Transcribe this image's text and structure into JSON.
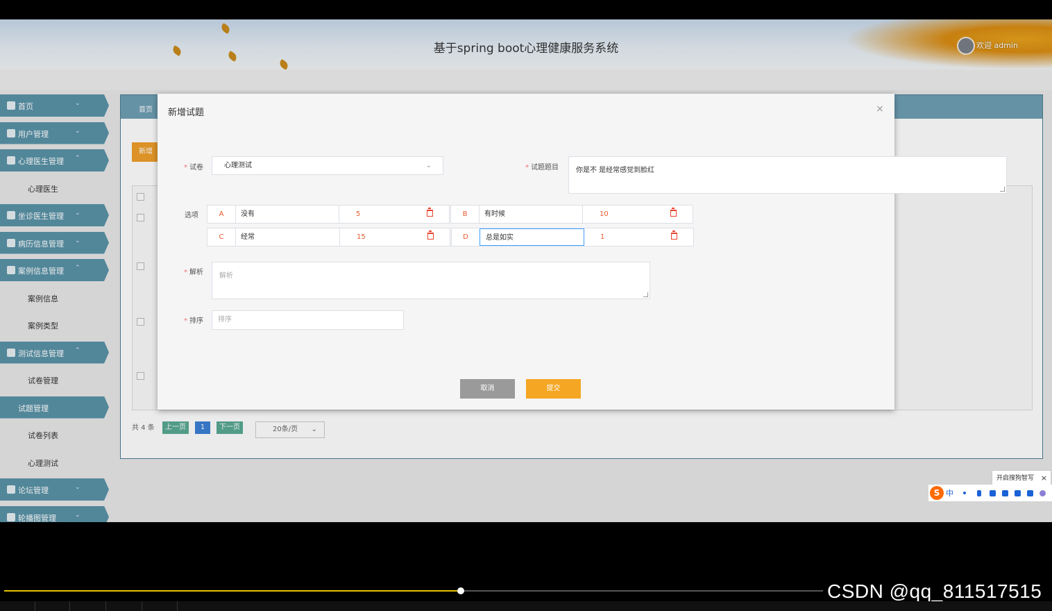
{
  "header": {
    "title": "基于spring boot心理健康服务系统",
    "welcome": "欢迎 admin"
  },
  "sidebar": {
    "items": [
      {
        "label": "首页",
        "kind": "parent",
        "chev": "⌄"
      },
      {
        "label": "用户管理",
        "kind": "parent",
        "chev": "⌄"
      },
      {
        "label": "心理医生管理",
        "kind": "parent",
        "chev": "⌃"
      },
      {
        "label": "心理医生",
        "kind": "child"
      },
      {
        "label": "坐诊医生管理",
        "kind": "parent",
        "chev": "⌄"
      },
      {
        "label": "病历信息管理",
        "kind": "parent",
        "chev": "⌄"
      },
      {
        "label": "案例信息管理",
        "kind": "parent",
        "chev": "⌃"
      },
      {
        "label": "案例信息",
        "kind": "child"
      },
      {
        "label": "案例类型",
        "kind": "child"
      },
      {
        "label": "测试信息管理",
        "kind": "parent",
        "chev": "⌃"
      },
      {
        "label": "试卷管理",
        "kind": "child"
      },
      {
        "label": "试题管理",
        "kind": "active"
      },
      {
        "label": "试卷列表",
        "kind": "child"
      },
      {
        "label": "心理测试",
        "kind": "child"
      },
      {
        "label": "论坛管理",
        "kind": "parent",
        "chev": "⌄"
      },
      {
        "label": "轮播图管理",
        "kind": "parent",
        "chev": "⌄"
      }
    ]
  },
  "content": {
    "breadcrumb": "首页",
    "new_button": "新增",
    "pager": {
      "total": "共 4 条",
      "prev": "上一页",
      "page": "1",
      "next": "下一页",
      "size": "20条/页"
    }
  },
  "modal": {
    "title": "新增试题",
    "close": "×",
    "paper_label": "试卷",
    "paper_value": "心理测试",
    "question_label": "试题题目",
    "question_value": "你是不 是经常感觉到脸红",
    "options_label": "选项",
    "options": [
      {
        "letter": "A",
        "text": "没有",
        "score": "5"
      },
      {
        "letter": "B",
        "text": "有时候",
        "score": "10"
      },
      {
        "letter": "C",
        "text": "经常",
        "score": "15"
      },
      {
        "letter": "D",
        "text": "总是如实",
        "score": "1"
      }
    ],
    "analysis_label": "解析",
    "analysis_placeholder": "解析",
    "sort_label": "排序",
    "sort_placeholder": "排序",
    "cancel": "取消",
    "submit": "提交"
  },
  "ime": {
    "tip": "开启搜狗智写",
    "close": "×",
    "logo": "S",
    "mode": "中"
  },
  "video": {
    "watermark": "CSDN @qq_811517515",
    "progress_fraction": 0.558
  },
  "colors": {
    "accent": "#f5a623",
    "nav": "#5a93a8",
    "danger": "#e8412c",
    "cancel": "#999999"
  }
}
